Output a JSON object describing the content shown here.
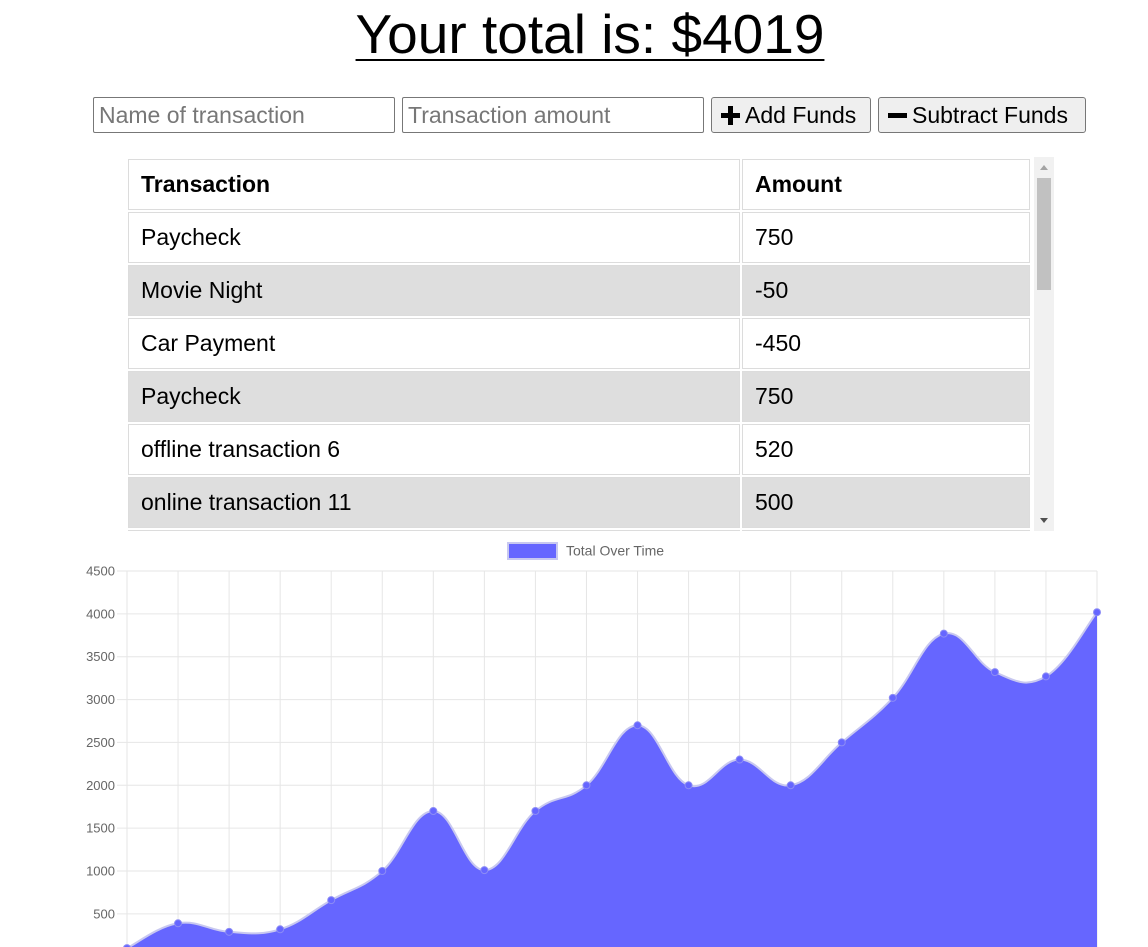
{
  "header": {
    "title_prefix": "Your total is: ",
    "title_amount": "$4019"
  },
  "form": {
    "name_placeholder": "Name of transaction",
    "amount_placeholder": "Transaction amount",
    "add_label": "Add Funds",
    "subtract_label": "Subtract Funds"
  },
  "table": {
    "headers": [
      "Transaction",
      "Amount"
    ],
    "rows": [
      {
        "name": "Paycheck",
        "amount": "750"
      },
      {
        "name": "Movie Night",
        "amount": "-50"
      },
      {
        "name": "Car Payment",
        "amount": "-450"
      },
      {
        "name": "Paycheck",
        "amount": "750"
      },
      {
        "name": "offline transaction 6",
        "amount": "520"
      },
      {
        "name": "online transaction 11",
        "amount": "500"
      }
    ]
  },
  "icons": {
    "add": "plus-icon",
    "subtract": "minus-icon"
  },
  "colors": {
    "area_fill": "#6666ff",
    "area_line": "#c8c8f0",
    "point": "#6666ff"
  },
  "chart_data": {
    "type": "area",
    "title": "",
    "xlabel": "",
    "ylabel": "",
    "legend": "Total Over Time",
    "legend_position": "top",
    "ylim": [
      0,
      4500
    ],
    "ytick_labels": [
      "4500",
      "4000",
      "3500",
      "3000",
      "2500",
      "2000",
      "1500",
      "1000",
      "500"
    ],
    "grid": true,
    "series": [
      {
        "name": "Total Over Time",
        "values": [
          100,
          390,
          290,
          320,
          660,
          1000,
          1700,
          1010,
          1700,
          2000,
          2700,
          2000,
          2300,
          2000,
          2500,
          3020,
          3770,
          3320,
          3270,
          4019
        ]
      }
    ]
  }
}
